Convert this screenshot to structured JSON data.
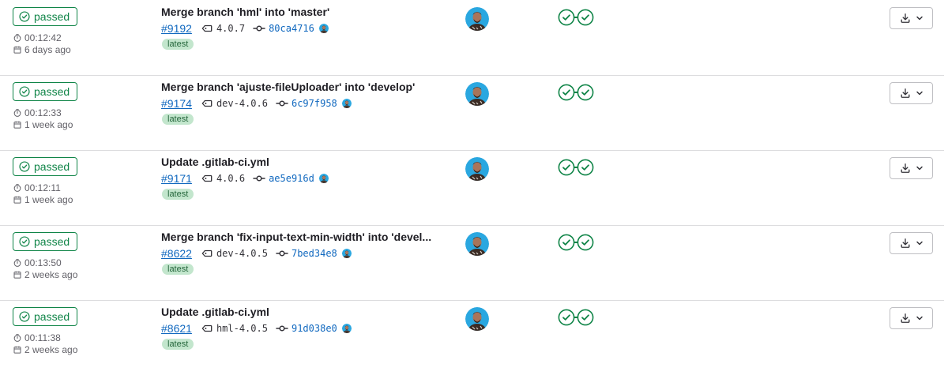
{
  "pipelines": [
    {
      "status": "passed",
      "duration": "00:12:42",
      "finished_ago": "6 days ago",
      "commit_title": "Merge branch 'hml' into 'master'",
      "pipeline_id": "#9192",
      "ref": "4.0.7",
      "sha": "80ca4716",
      "badge": "latest",
      "stages": [
        "passed",
        "passed"
      ]
    },
    {
      "status": "passed",
      "duration": "00:12:33",
      "finished_ago": "1 week ago",
      "commit_title": "Merge branch 'ajuste-fileUploader' into 'develop'",
      "pipeline_id": "#9174",
      "ref": "dev-4.0.6",
      "sha": "6c97f958",
      "badge": "latest",
      "stages": [
        "passed",
        "passed"
      ]
    },
    {
      "status": "passed",
      "duration": "00:12:11",
      "finished_ago": "1 week ago",
      "commit_title": "Update .gitlab-ci.yml",
      "pipeline_id": "#9171",
      "ref": "4.0.6",
      "sha": "ae5e916d",
      "badge": "latest",
      "stages": [
        "passed",
        "passed"
      ]
    },
    {
      "status": "passed",
      "duration": "00:13:50",
      "finished_ago": "2 weeks ago",
      "commit_title": "Merge branch 'fix-input-text-min-width' into 'devel...",
      "pipeline_id": "#8622",
      "ref": "dev-4.0.5",
      "sha": "7bed34e8",
      "badge": "latest",
      "stages": [
        "passed",
        "passed"
      ]
    },
    {
      "status": "passed",
      "duration": "00:11:38",
      "finished_ago": "2 weeks ago",
      "commit_title": "Update .gitlab-ci.yml",
      "pipeline_id": "#8621",
      "ref": "hml-4.0.5",
      "sha": "91d038e0",
      "badge": "latest",
      "stages": [
        "passed",
        "passed"
      ]
    }
  ],
  "icons": {
    "status": "status-success-icon",
    "duration": "timer-icon",
    "date": "calendar-icon",
    "ref": "tag-icon",
    "commit": "commit-icon",
    "stage": "check-circle-icon",
    "artifacts": "download-icon",
    "dropdown": "chevron-down-icon"
  },
  "colors": {
    "success": "#108548",
    "link": "#1068bf",
    "badge_bg": "#c3e6cd",
    "badge_text": "#24663b",
    "border": "#dcdcde"
  }
}
